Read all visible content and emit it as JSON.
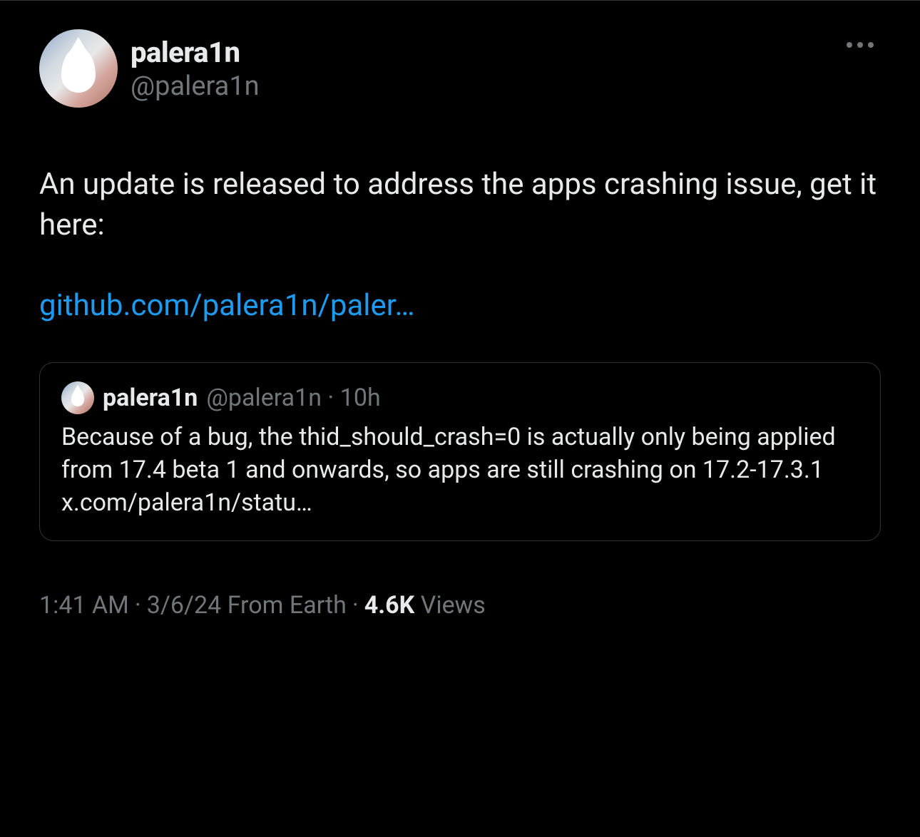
{
  "tweet": {
    "author": {
      "display_name": "palera1n",
      "handle": "@palera1n"
    },
    "body_text": "An update is released to address the apps crashing issue, get it here:",
    "link_text": "github.com/palera1n/paler…",
    "quoted": {
      "author": {
        "display_name": "palera1n",
        "handle": "@palera1n",
        "time": "10h"
      },
      "text": "Because of a bug, the thid_should_crash=0 is actually only being applied from 17.4 beta 1 and onwards, so apps are still crashing on 17.2-17.3.1 x.com/palera1n/statu…"
    },
    "meta": {
      "time": "1:41 AM",
      "date": "3/6/24",
      "from": "From Earth",
      "views_count": "4.6K",
      "views_label": "Views"
    }
  }
}
